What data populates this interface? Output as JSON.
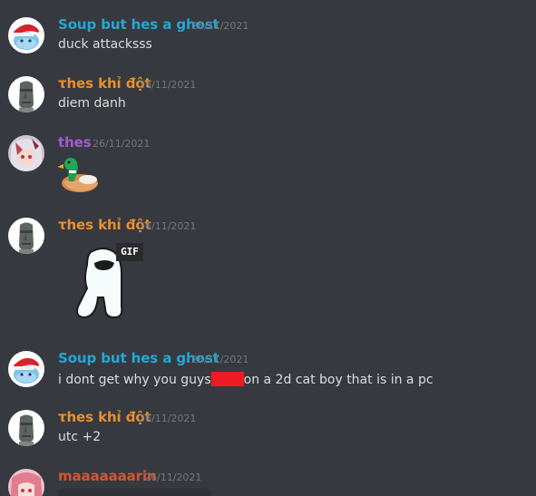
{
  "channel": {
    "messages": [
      {
        "username": "Soup but hes a ghost",
        "username_color": "#22a8d6",
        "timestamp": "26/11/2021",
        "avatar_icon": "santa-hat-ghost-avatar",
        "text": "duck attacksss"
      },
      {
        "username": "τhes khỉ đột",
        "username_color": "#ea8f2c",
        "timestamp": "26/11/2021",
        "avatar_icon": "moai-avatar",
        "text": "diem danh"
      },
      {
        "username": "thes",
        "username_color": "#a15dc9",
        "timestamp": "26/11/2021",
        "avatar_icon": "anime-girl-avatar",
        "emoji": "duck-emoji"
      },
      {
        "username": "τhes khỉ đột",
        "username_color": "#ea8f2c",
        "timestamp": "26/11/2021",
        "avatar_icon": "moai-avatar",
        "attachment": "among-us-ghost-gif",
        "gif_label": "GIF"
      },
      {
        "username": "Soup but hes a ghost",
        "username_color": "#22a8d6",
        "timestamp": "26/11/2021",
        "avatar_icon": "santa-hat-ghost-avatar",
        "text_before": "i dont get why you guys",
        "text_after": "on a 2d cat boy that is in a pc",
        "redaction_color": "#ed1c24"
      },
      {
        "username": "τhes khỉ đột",
        "username_color": "#ea8f2c",
        "timestamp": "26/11/2021",
        "avatar_icon": "moai-avatar",
        "text": "utc +2"
      },
      {
        "username": "maaaaaaarin",
        "username_color": "#d4572e",
        "timestamp": "26/11/2021",
        "avatar_icon": "anime-girl-pink-avatar"
      }
    ]
  }
}
